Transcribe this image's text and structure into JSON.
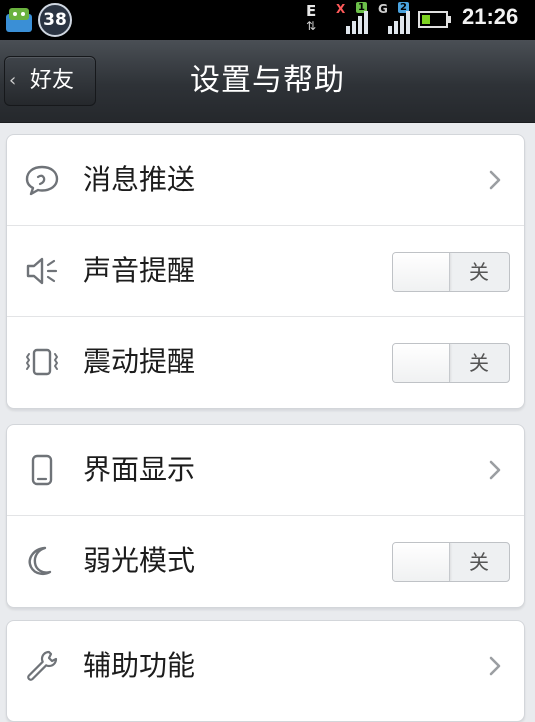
{
  "status_bar": {
    "notification_count": "38",
    "network_e": "E",
    "sim1_tag": "X",
    "sim1_number": "1",
    "sim2_tag": "G",
    "sim2_number": "2",
    "battery_level": 0.35,
    "time": "21:26"
  },
  "header": {
    "back_label": "好友",
    "title": "设置与帮助"
  },
  "settings": {
    "group1": [
      {
        "label": "消息推送",
        "icon": "chat-bubble-icon",
        "control": "chevron"
      },
      {
        "label": "声音提醒",
        "icon": "speaker-icon",
        "control": "toggle",
        "state": "关"
      },
      {
        "label": "震动提醒",
        "icon": "vibration-icon",
        "control": "toggle",
        "state": "关"
      }
    ],
    "group2": [
      {
        "label": "界面显示",
        "icon": "phone-icon",
        "control": "chevron"
      },
      {
        "label": "弱光模式",
        "icon": "moon-icon",
        "control": "toggle",
        "state": "关"
      }
    ],
    "group3": [
      {
        "label": "辅助功能",
        "icon": "wrench-icon",
        "control": "chevron"
      }
    ]
  },
  "colors": {
    "background": "#e9ebee",
    "titlebar": "#2e3237",
    "battery_fill": "#7ed321",
    "sim1_badge": "#6cc04a",
    "sim2_badge": "#4aa3df"
  }
}
